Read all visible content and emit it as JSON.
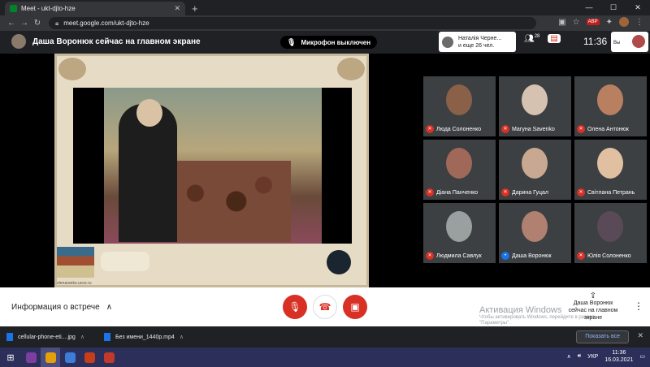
{
  "browser": {
    "tab_title": "Meet - ukt-djto-hze",
    "tab_close": "✕",
    "new_tab": "+",
    "url": "meet.google.com/ukt-djto-hze",
    "ext_abp": "ABP",
    "window_controls": {
      "minimize": "—",
      "maximize": "☐",
      "close": "✕"
    }
  },
  "meet": {
    "header_title": "Даша Воронюк сейчас на главном экране",
    "mic_status": "Микрофон выключен",
    "participants_line1": "Наталія Черне...",
    "participants_line2": "и еще 26 чел.",
    "people_count": "28",
    "clock": "11:36",
    "self_label": "Вы",
    "slide_watermark": "elenaranko.ucoz.ru"
  },
  "participants": [
    {
      "name": "Люда Солоненко",
      "muted": true,
      "face_color": "#8a6048"
    },
    {
      "name": "Магуна Savenko",
      "muted": true,
      "face_color": "#d6c2b0"
    },
    {
      "name": "Олена Антонюк",
      "muted": true,
      "face_color": "#b88060"
    },
    {
      "name": "Діана Панченко",
      "muted": true,
      "face_color": "#a06858"
    },
    {
      "name": "Дарина Гуцал",
      "muted": true,
      "face_color": "#c8a890"
    },
    {
      "name": "Світлана Петрань",
      "muted": true,
      "face_color": "#e0c0a0"
    },
    {
      "name": "Людмила Савлук",
      "muted": true,
      "face_color": "#9aa0a0"
    },
    {
      "name": "Даша Воронюк",
      "muted": false,
      "face_color": "#b08070"
    },
    {
      "name": "Юлія Солоненко",
      "muted": true,
      "face_color": "#5a4a58"
    }
  ],
  "controls": {
    "meeting_info": "Информация о встрече",
    "meeting_info_caret": "∧",
    "presenter_line1": "Даша Воронюк",
    "presenter_line2": "сейчас на главном экране",
    "more_icon": "⋮"
  },
  "windows_activation": {
    "title": "Активация Windows",
    "line1": "Чтобы активировать Windows, перейдите в раздел",
    "line2": "\"Параметры\"."
  },
  "downloads": [
    {
      "name": "cellular-phone-eti....jpg"
    },
    {
      "name": "Без имени_1440p.mp4"
    }
  ],
  "downloads_show_all": "Показать все",
  "downloads_close": "✕",
  "taskbar": {
    "lang": "УКР",
    "time": "11:36",
    "date": "16.03.2021",
    "apps": [
      "#7b3fa0",
      "#e4a00a",
      "#3b7dd8",
      "#c43e1c",
      "#c0392b"
    ]
  }
}
